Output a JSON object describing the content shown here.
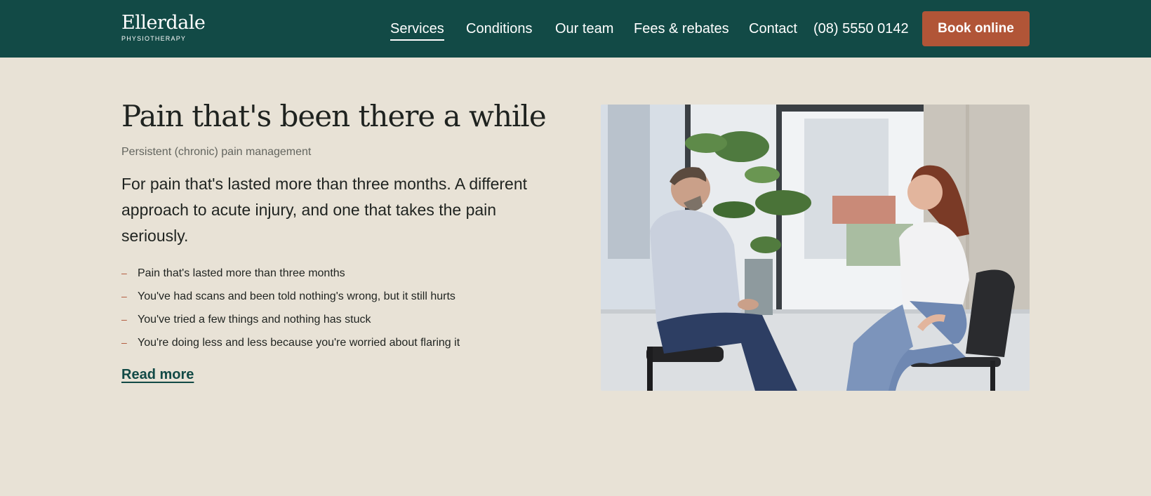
{
  "brand": {
    "name": "Ellerdale",
    "tagline": "PHYSIOTHERAPY"
  },
  "nav": {
    "items": [
      {
        "label": "Services",
        "active": true
      },
      {
        "label": "Conditions",
        "active": false
      },
      {
        "label": "Our team",
        "active": false
      },
      {
        "label": "Fees & rebates",
        "active": false
      },
      {
        "label": "Contact",
        "active": false
      }
    ],
    "phone": "(08) 5550 0142",
    "cta_label": "Book online"
  },
  "main": {
    "title": "Pain that's been there a while",
    "subtitle": "Persistent (chronic) pain management",
    "lede": "For pain that's lasted more than three months. A different approach to acute injury, and one that takes the pain seriously.",
    "bullets": [
      "Pain that's lasted more than three months",
      "You've had scans and been told nothing's wrong, but it still hurts",
      "You've tried a few things and nothing has stuck",
      "You're doing less and less because you're worried about flaring it"
    ],
    "bullet_marker": "–",
    "read_more": "Read more"
  },
  "colors": {
    "header_bg": "#124a46",
    "page_bg": "#e8e2d6",
    "accent": "#b15537"
  },
  "image": {
    "alt_semantic": "physio-consultation-photo"
  }
}
